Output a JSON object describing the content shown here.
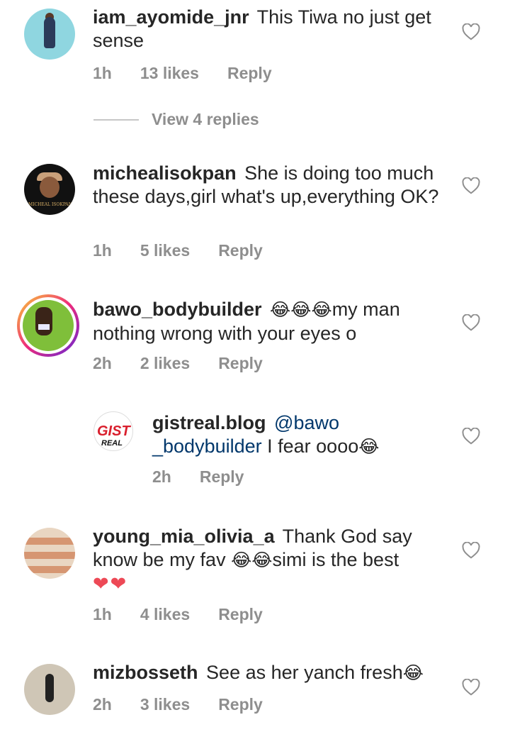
{
  "comments": [
    {
      "username": "iam_ayomide_jnr",
      "text": "This Tiwa no just get sense",
      "time": "1h",
      "likes": "13 likes",
      "reply": "Reply",
      "view_replies": "View 4 replies"
    },
    {
      "username": "michealisokpan",
      "text": "She is doing  too much these days,girl what's up,everything OK?",
      "time": "1h",
      "likes": "5 likes",
      "reply": "Reply",
      "avatar_tag": "MICHEAL ISOKPAN"
    },
    {
      "username": "bawo_bodybuilder",
      "emoji": "😂😂😂",
      "text": "my man nothing wrong with your eyes o",
      "time": "2h",
      "likes": "2 likes",
      "reply": "Reply"
    },
    {
      "username": "gistreal.blog",
      "mention": "@bawo _bodybuilder",
      "text": " I fear oooo",
      "emoji": "😂",
      "time": "2h",
      "reply": "Reply",
      "avatar_logo_top": "GIST",
      "avatar_logo_bottom": "REAL"
    },
    {
      "username": "young_mia_olivia_a",
      "text": "Thank God say know be my fav ",
      "emoji": "😂😂",
      "text2": "simi is the best",
      "hearts": "❤❤",
      "time": "1h",
      "likes": "4 likes",
      "reply": "Reply"
    },
    {
      "username": "mizbosseth",
      "text": "See as her yanch fresh",
      "emoji": "😂",
      "time": "2h",
      "likes": "3 likes",
      "reply": "Reply"
    }
  ],
  "icons": {
    "like": "heart-outline-icon"
  },
  "colors": {
    "text": "#262626",
    "secondary": "#8e8e8e",
    "mention": "#00376b",
    "heart_red": "#ed4956"
  }
}
